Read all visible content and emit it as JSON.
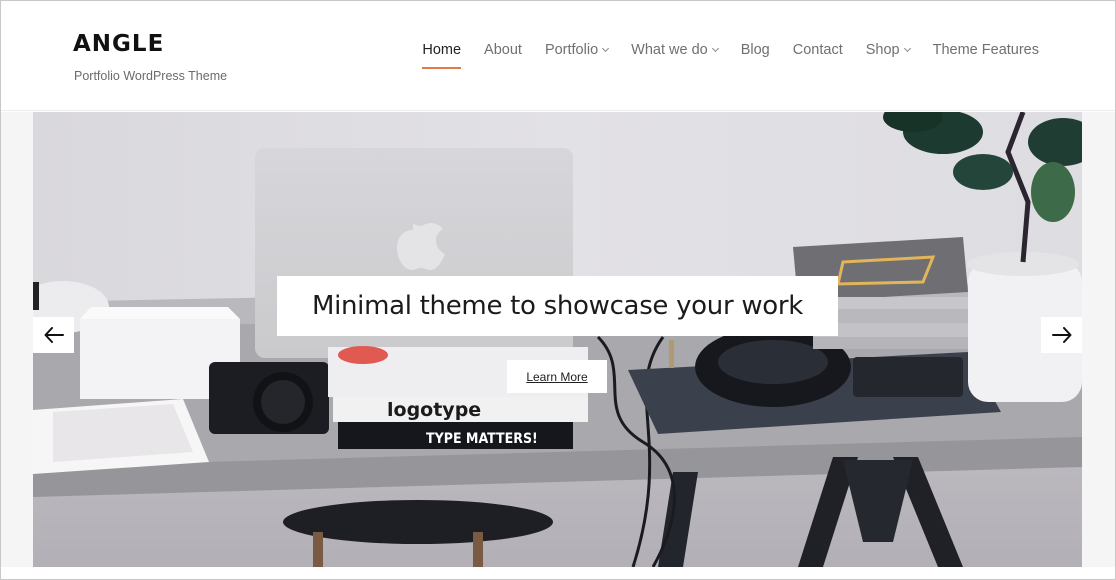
{
  "site": {
    "title": "ANGLE",
    "tagline": "Portfolio WordPress Theme"
  },
  "nav": {
    "items": [
      {
        "label": "Home",
        "active": true,
        "has_dropdown": false
      },
      {
        "label": "About",
        "active": false,
        "has_dropdown": false
      },
      {
        "label": "Portfolio",
        "active": false,
        "has_dropdown": true
      },
      {
        "label": "What we do",
        "active": false,
        "has_dropdown": true
      },
      {
        "label": "Blog",
        "active": false,
        "has_dropdown": false
      },
      {
        "label": "Contact",
        "active": false,
        "has_dropdown": false
      },
      {
        "label": "Shop",
        "active": false,
        "has_dropdown": true
      },
      {
        "label": "Theme Features",
        "active": false,
        "has_dropdown": false
      }
    ],
    "active_underline_color": "#e37a49"
  },
  "hero": {
    "caption": "Minimal theme to showcase your work",
    "button_label": "Learn More",
    "prev_icon": "arrow-left-icon",
    "next_icon": "arrow-right-icon",
    "image_description": "Desk with laptop, camera, books, headphones and plant",
    "book_texts": {
      "logotype": "logotype",
      "type_matters": "TYPE MATTERS!"
    }
  }
}
